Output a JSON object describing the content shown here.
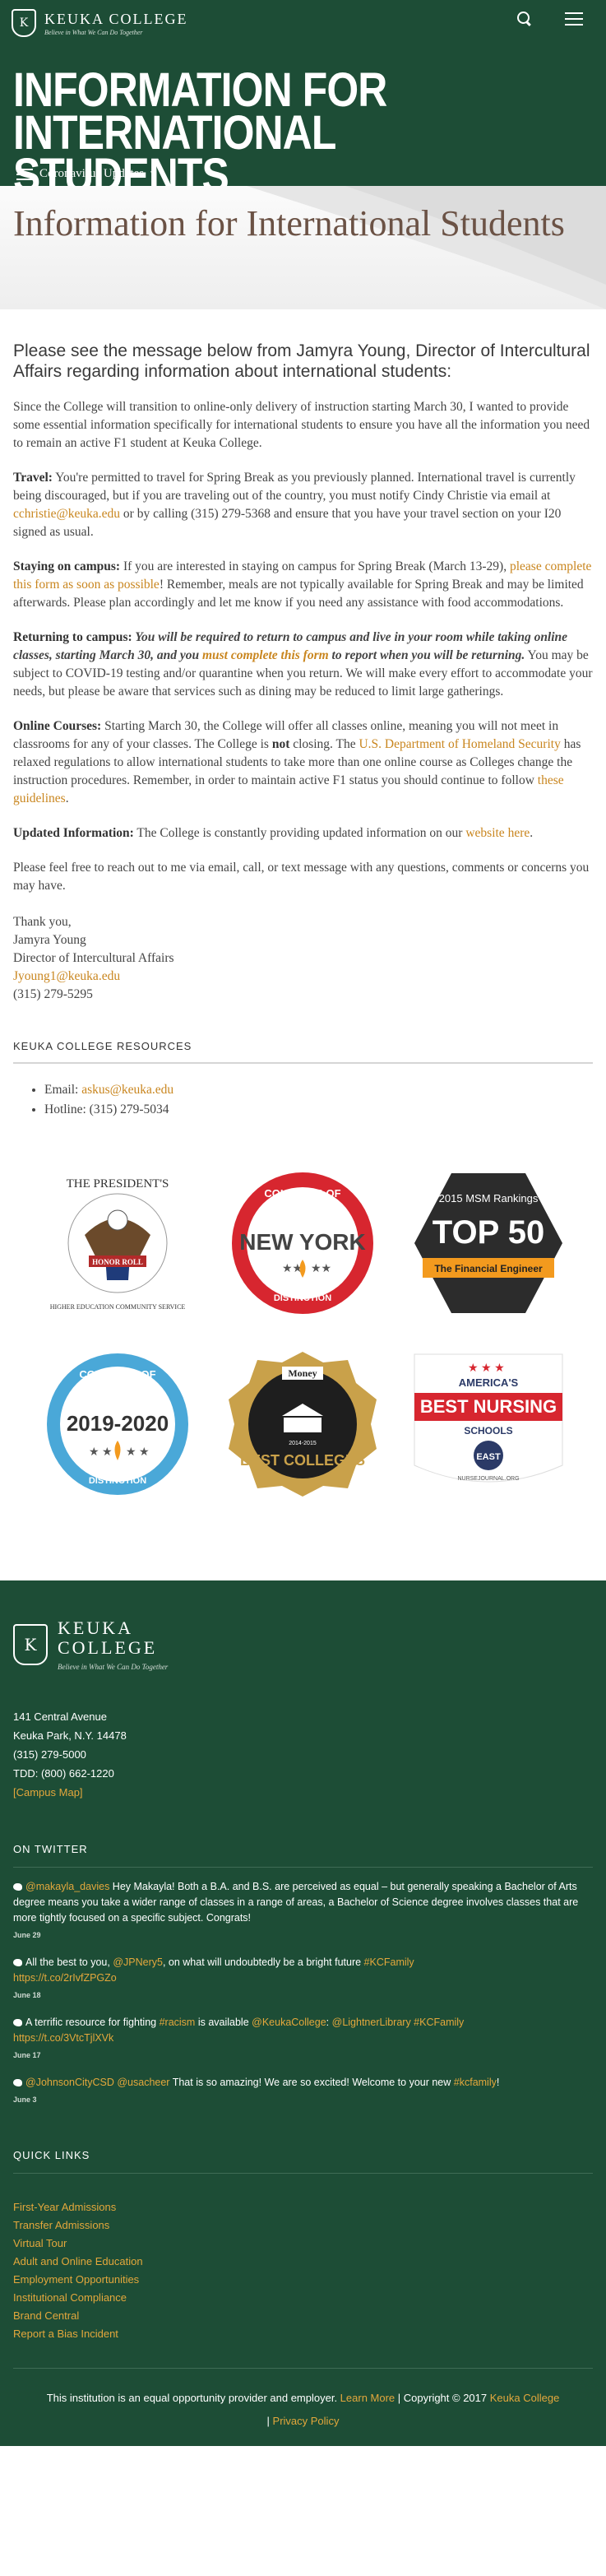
{
  "header": {
    "logo_mark": "K",
    "logo_name": "KEUKA COLLEGE",
    "logo_tagline": "Believe in What We Can Do Together"
  },
  "hero": {
    "title_line1": "INFORMATION FOR INTERNATIONAL",
    "title_line2": "STUDENTS",
    "subnav_label": "Coronavirus Updates"
  },
  "page_title": "Information for International Students",
  "lead": "Please see the message below from Jamyra Young, Director of Intercultural Affairs regarding information about international students:",
  "intro": "Since the College will transition to online-only delivery of instruction starting March 30, I wanted to provide some essential  information specifically  for international students  to ensure you have all the information  you need to remain an active F1 student at Keuka College.",
  "travel": {
    "heading": "Travel:",
    "text1": " You're permitted to travel for Spring Break as you previously  planned. International travel is currently being discouraged, but if you are traveling out of the  country, you must notify Cindy Christie via email at ",
    "email": "cchristie@keuka.edu",
    "text2": " or by calling (315) 279-5368 and ensure that you have your travel section on your I20 signed as usual."
  },
  "campus": {
    "heading": "Staying on campus:",
    "text1": " If you are interested in staying on campus for Spring Break (March 13-29),  ",
    "link": "please complete this form as  soon as possible",
    "text2": "! Remember, meals are not typically available for Spring Break and may be limited afterwards. Please plan accordingly and let me know if you need any assistance with food accommodations."
  },
  "returning": {
    "heading": "Returning to campus:",
    "emph1": " You will be required to return to campus and live in your room while taking online classes, starting March 30, and you  ",
    "link": "must complete this form",
    "emph2": "  to report when you will be returning.",
    "text": "  You may be subject to COVID-19 testing and/or quarantine when you return. We will make every effort to accommodate your needs, but please be aware that services such as dining may be reduced to limit large gatherings."
  },
  "online": {
    "heading": "Online Courses:",
    "text1": " Starting March 30, the College will offer all classes online, meaning you will not meet in classrooms for any of your classes. The College is ",
    "not": " not ",
    "text2": " closing. The  ",
    "link1": "U.S. Department of Homeland Security",
    "text3": "  has relaxed regulations to allow international students to take more than one online course as Colleges change the instruction procedures. Remember, in order to maintain active F1 status you should continue to follow  ",
    "link2": "these guidelines",
    "text4": "."
  },
  "updated": {
    "heading": "Updated Information:",
    "text": " The College is constantly providing updated information on our  ",
    "link": "website here",
    "end": "."
  },
  "closing": "Please feel free to reach out to me via email, call, or text message with any questions, comments or concerns you may have.",
  "signature": {
    "thanks": "Thank you,",
    "name": "Jamyra Young",
    "title": "Director of Intercultural Affairs",
    "email": "Jyoung1@keuka.edu",
    "phone": "(315) 279-5295"
  },
  "resources": {
    "heading": "KEUKA COLLEGE RESOURCES",
    "email_label": "Email: ",
    "email": "askus@keuka.edu",
    "hotline": "Hotline: (315) 279-5034"
  },
  "badges": {
    "presidents": {
      "top": "THE PRESIDENT'S",
      "ribbon": "HONOR ROLL",
      "side": "HIGHER EDUCATION COMMUNITY SERVICE"
    },
    "colleges_ny": {
      "top": "COLLEGES OF",
      "main": "NEW YORK",
      "bottom": "DISTINCTION"
    },
    "msm": {
      "top": "2015 MSM Rankings",
      "main": "TOP 50",
      "bottom": "The Financial Engineer"
    },
    "cod": {
      "top": "COLLEGES OF",
      "main": "2019-2020",
      "bottom": "DISTINCTION"
    },
    "money": {
      "brand": "Money",
      "main": "BEST COLLEGES",
      "year": "2014-2015"
    },
    "nursing": {
      "top": "AMERICA'S",
      "main": "BEST NURSING",
      "sub": "SCHOOLS",
      "region": "EAST",
      "url": "NURSEJOURNAL.ORG"
    },
    "colors": {
      "green": "#1d4d36",
      "red": "#d7262f",
      "blue": "#4aa8d8",
      "gold": "#c9a14a",
      "orange": "#f39a1e",
      "navy": "#2b3a67"
    }
  },
  "footer": {
    "logo_mark": "K",
    "name_line1": "KEUKA",
    "name_line2": "COLLEGE",
    "tagline": "Believe in What We Can Do Together",
    "address1": "141 Central Avenue",
    "address2": "Keuka Park, N.Y. 14478",
    "phone": "(315) 279-5000",
    "tdd": "TDD: (800) 662-1220",
    "map_link": "[Campus Map]",
    "twitter_heading": "ON TWITTER",
    "tweets": [
      {
        "handle": "@makayla_davies",
        "text": " Hey Makayla! Both a B.A. and B.S. are perceived as equal – but generally speaking a Bachelor of Arts degree means you take a wider range of classes in a range of areas, a Bachelor of Science degree involves classes that are more tightly focused on a specific subject. Congrats!",
        "date": "June 29"
      },
      {
        "pre": "All the best to you, ",
        "handle": "@JPNery5",
        "text": ", on what will undoubtedly be a bright future ",
        "tag": "#KCFamily",
        "link": "https://t.co/2rIvfZPGZo",
        "date": "June 18"
      },
      {
        "pre": "A terrific resource for fighting ",
        "tag1": "#racism",
        "mid": " is available ",
        "handle": "@KeukaCollege",
        "sep": ": ",
        "handle2": "@LightnerLibrary",
        "tag2": " #KCFamily",
        "link": "https://t.co/3VtcTjlXVk",
        "date": "June 17"
      },
      {
        "handle": "@JohnsonCityCSD",
        "handle2": " @usacheer",
        "text": " That is so amazing! We are so excited! Welcome to your new ",
        "tag": "#kcfamily",
        "end": "!",
        "date": "June 3"
      }
    ],
    "links_heading": "QUICK LINKS",
    "links": [
      "First-Year Admissions",
      "Transfer Admissions",
      "Virtual Tour",
      "Adult and Online Education",
      "Employment Opportunities",
      "Institutional Compliance",
      "Brand Central",
      "Report a Bias Incident"
    ],
    "bottom_text": "This institution is an equal opportunity provider and employer. ",
    "learn_more": "Learn More",
    "sep": "  |  ",
    "copyright": "Copyright © 2017 ",
    "copyright_link": "Keuka College",
    "privacy_sep": "|  ",
    "privacy": "Privacy Policy"
  }
}
